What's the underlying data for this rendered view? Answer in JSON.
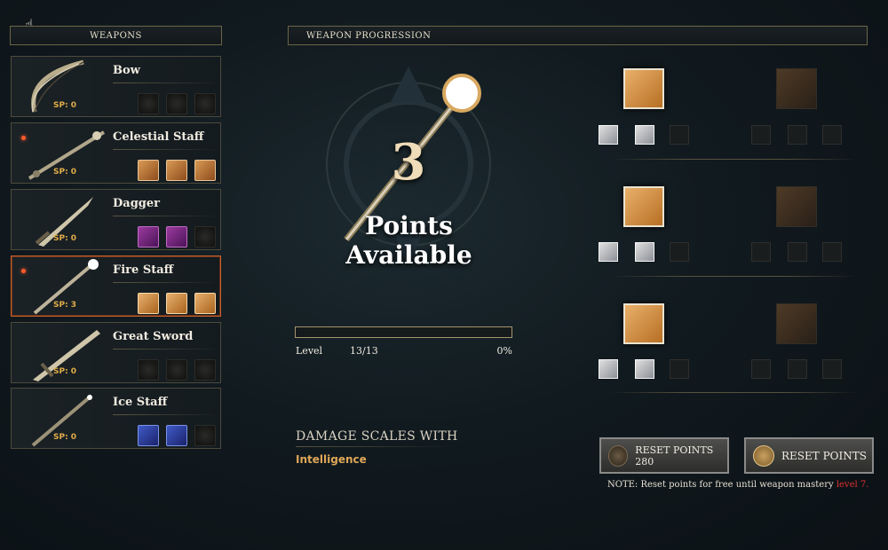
{
  "headers": {
    "weapons": "WEAPONS",
    "progression": "WEAPON PROGRESSION"
  },
  "weapons": [
    {
      "name": "Bow",
      "sp": "SP: 0",
      "selected": false,
      "slots": [
        "empty",
        "empty",
        "empty"
      ]
    },
    {
      "name": "Celestial Staff",
      "sp": "SP: 0",
      "selected": false,
      "slots": [
        "orange",
        "orange",
        "orange"
      ]
    },
    {
      "name": "Dagger",
      "sp": "SP: 0",
      "selected": false,
      "slots": [
        "pink",
        "pink",
        "empty"
      ]
    },
    {
      "name": "Fire Staff",
      "sp": "SP: 3",
      "selected": true,
      "slots": [
        "firelit",
        "firelit",
        "firelit"
      ]
    },
    {
      "name": "Great Sword",
      "sp": "SP: 0",
      "selected": false,
      "slots": [
        "empty",
        "empty",
        "empty"
      ]
    },
    {
      "name": "Ice Staff",
      "sp": "SP: 0",
      "selected": false,
      "slots": [
        "blue",
        "blue",
        "empty"
      ]
    }
  ],
  "points": {
    "number": "3",
    "label": "Points Available"
  },
  "level": {
    "label": "Level",
    "value": "13/13",
    "percent": "0%",
    "progress": 0
  },
  "damage": {
    "title": "DAMAGE SCALES WITH",
    "attribute": "Intelligence"
  },
  "buttons": {
    "reset_gold": "RESET POINTS 280",
    "reset_coin": "RESET POINTS"
  },
  "note": {
    "text": "NOTE: Reset points for free until weapon mastery ",
    "highlight": "level 7."
  },
  "colors": {
    "accent": "#e0a758",
    "selected_border": "#c8602a",
    "note_red": "#e03030"
  },
  "icons": [
    "fire-node-icon",
    "flame-skill-icon",
    "burst-skill-icon",
    "gold-coin-icon",
    "token-icon"
  ]
}
